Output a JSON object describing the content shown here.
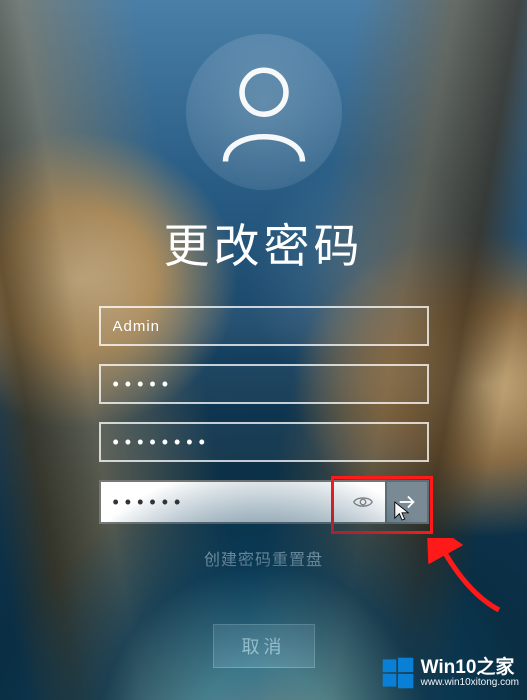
{
  "title": "更改密码",
  "username": {
    "value": "Admin"
  },
  "old_password": {
    "mask": "•••••"
  },
  "new_password": {
    "mask": "••••••••"
  },
  "confirm_password": {
    "mask": "••••••"
  },
  "reset_link": "创建密码重置盘",
  "cancel_label": "取消",
  "watermark": {
    "title": "Win10之家",
    "url": "www.win10xitong.com"
  },
  "icons": {
    "avatar": "user-icon",
    "reveal": "eye-icon",
    "submit": "arrow-right-icon",
    "wm_logo": "windows-logo-icon"
  },
  "colors": {
    "highlight": "#ff1a1a",
    "submit_bg": "#7a8a95",
    "wm_accent": "#0a7fd6"
  }
}
